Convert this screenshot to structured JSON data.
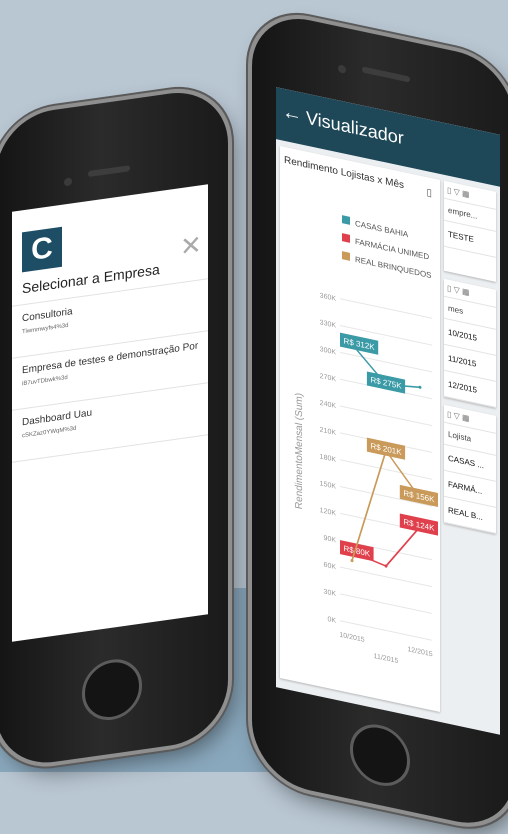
{
  "left_phone": {
    "logo_glyph": "C",
    "close_glyph": "✕",
    "title": "Selecionar a Empresa",
    "companies": [
      {
        "name": "Consultoria",
        "code": "Tiwmmwyfs4%3d"
      },
      {
        "name": "Empresa de testes e demonstração Port...",
        "code": "iB7uvTDbwk%3d"
      },
      {
        "name": "Dashboard Uau",
        "code": "cSKZaz0YWqM%3d"
      }
    ]
  },
  "right_phone": {
    "back_glyph": "←",
    "title": "Visualizador",
    "chart_card_title": "Rendimento Lojistas x Mês",
    "pdf_glyph": "▯",
    "side_cards": [
      {
        "icons": "▯ ▽ ▦",
        "header": "empre...",
        "rows": [
          "TESTE"
        ]
      },
      {
        "icons": "▯ ▽ ▦",
        "header": "mes",
        "rows": [
          "10/2015",
          "11/2015",
          "12/2015"
        ]
      },
      {
        "icons": "▯ ▽ ▦",
        "header": "Lojista",
        "rows": [
          "CASAS ...",
          "FARMÁ...",
          "REAL B..."
        ]
      }
    ]
  },
  "chart_data": {
    "type": "line",
    "ylabel": "RendimentoMensal (Sum)",
    "xlabel": "11/2015",
    "x_ticks": [
      "10/2015",
      "12/2015"
    ],
    "x": [
      "10/2015",
      "11/2015",
      "12/2015"
    ],
    "ylim": [
      0,
      360000
    ],
    "y_ticks": [
      "0K",
      "30K",
      "60K",
      "90K",
      "120K",
      "150K",
      "180K",
      "210K",
      "240K",
      "270K",
      "300K",
      "330K",
      "360K"
    ],
    "grid": true,
    "legend_position": "top",
    "series": [
      {
        "name": "CASAS BAHIA",
        "color": "#3a9aa6",
        "values": [
          312000,
          275000,
          280000
        ],
        "labels": [
          "R$ 312K",
          "R$ 275K",
          ""
        ]
      },
      {
        "name": "FARMÁCIA UNIMED",
        "color": "#e0404c",
        "values": [
          80000,
          72000,
          124000
        ],
        "labels": [
          "R$ 80K",
          "",
          "R$ 124K"
        ]
      },
      {
        "name": "REAL BRINQUEDOS",
        "color": "#c99a5a",
        "values": [
          70000,
          201000,
          156000
        ],
        "labels": [
          "",
          "R$ 201K",
          "R$ 156K"
        ]
      }
    ]
  }
}
